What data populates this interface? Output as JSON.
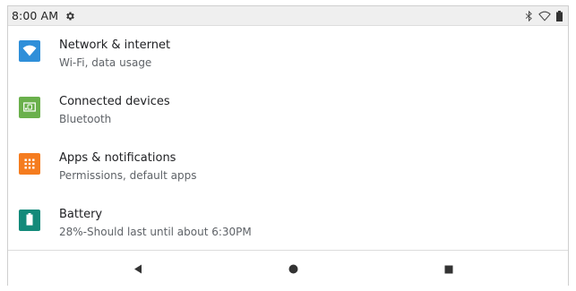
{
  "status_bar": {
    "time": "8:00 AM",
    "icons": [
      "gear-icon",
      "bluetooth-icon",
      "wifi-icon",
      "battery-icon"
    ]
  },
  "settings": {
    "items": [
      {
        "title": "Network & internet",
        "subtitle": "Wi-Fi, data usage",
        "icon": "wifi-icon",
        "color": "#2f8fd9"
      },
      {
        "title": "Connected devices",
        "subtitle": "Bluetooth",
        "icon": "devices-icon",
        "color": "#6ab04c"
      },
      {
        "title": "Apps & notifications",
        "subtitle": "Permissions, default apps",
        "icon": "apps-grid-icon",
        "color": "#f57c1f"
      },
      {
        "title": "Battery",
        "subtitle": "28%-Should last until about 6:30PM",
        "icon": "battery-icon",
        "color": "#138a7a"
      }
    ]
  },
  "nav_bar": {
    "buttons": [
      "back-icon",
      "home-icon",
      "recents-icon"
    ]
  }
}
